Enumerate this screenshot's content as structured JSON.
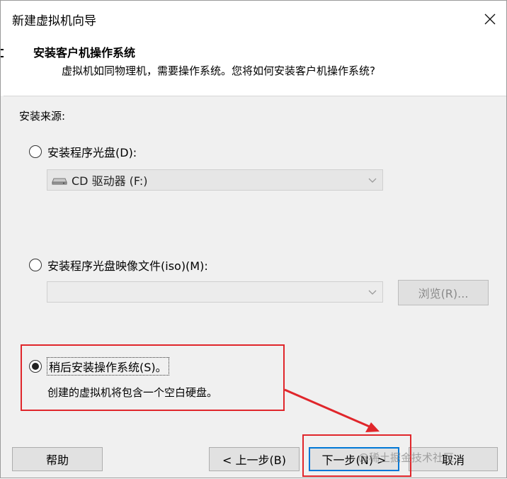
{
  "window": {
    "title": "新建虚拟机向导"
  },
  "header": {
    "title": "安装客户机操作系统",
    "subtitle": "虚拟机如同物理机，需要操作系统。您将如何安装客户机操作系统?"
  },
  "install_source": {
    "label": "安装来源:",
    "disc_option": {
      "label": "安装程序光盘(D):",
      "selected": false
    },
    "disc_drive": {
      "value": "CD 驱动器 (F:)"
    },
    "iso_option": {
      "label": "安装程序光盘映像文件(iso)(M):",
      "selected": false
    },
    "iso_path": {
      "value": ""
    },
    "browse_label": "浏览(R)...",
    "later_option": {
      "label": "稍后安装操作系统(S)。",
      "selected": true
    },
    "later_description": "创建的虚拟机将包含一个空白硬盘。"
  },
  "footer": {
    "help_label": "帮助",
    "back_label": "< 上一步(B)",
    "next_label": "下一步(N) >",
    "cancel_label": "取消"
  },
  "watermark": "@稀土掘金技术社区",
  "colors": {
    "highlight_red": "#e0262b"
  }
}
